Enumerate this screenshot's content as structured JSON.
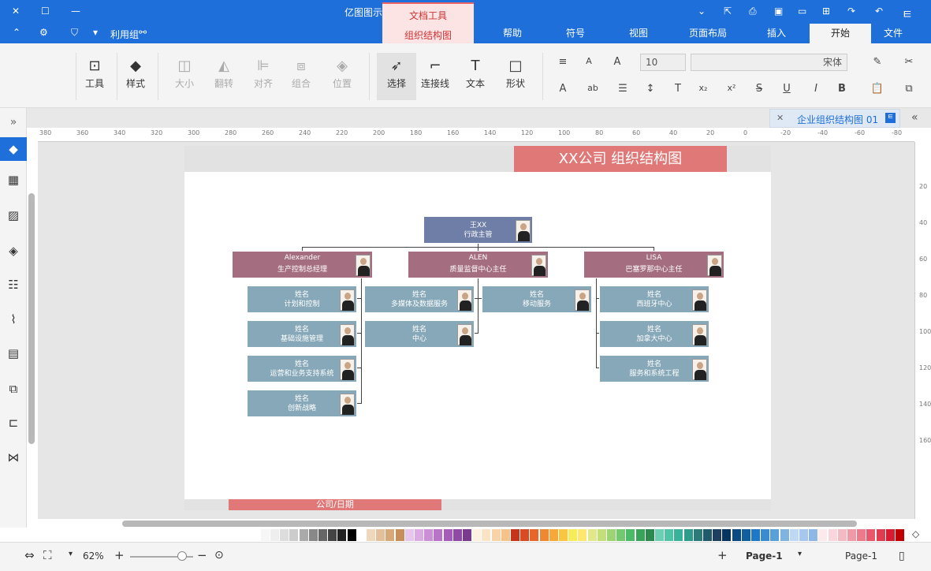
{
  "app": {
    "title": "亿图图示",
    "quick_access": [
      "利用组"
    ]
  },
  "context_tab": {
    "group": "文档工具",
    "name": "组织结构图"
  },
  "tabs": [
    "文件",
    "开始",
    "插入",
    "页面布局",
    "视图",
    "符号",
    "帮助"
  ],
  "ribbon": {
    "left_group": {
      "tool": "工具",
      "style": "样式"
    },
    "arrange": [
      "大小",
      "翻转",
      "对齐",
      "组合",
      "位置"
    ],
    "tools": {
      "select": "选择",
      "connector": "连接线",
      "text": "文本",
      "shape": "形状"
    },
    "font_name": "宋体",
    "font_size": "10",
    "buttons_row2": [
      "B",
      "I",
      "U",
      "S",
      "x²",
      "x₂"
    ]
  },
  "document_tab": "企业组织结构图 01",
  "ruler": {
    "h": [
      "380",
      "360",
      "340",
      "320",
      "300",
      "280",
      "260",
      "240",
      "220",
      "200",
      "180",
      "160",
      "140",
      "120",
      "100",
      "80",
      "60",
      "40",
      "20",
      "0",
      "-20",
      "-40",
      "-60",
      "-80"
    ],
    "v": [
      "20",
      "40",
      "60",
      "80",
      "100",
      "120",
      "140",
      "160"
    ]
  },
  "diagram": {
    "title": "XX公司  组织结构图",
    "footer": "公司/日期",
    "top": {
      "name": "王XX",
      "title": "行政主管"
    },
    "managers": [
      {
        "name": "Alexander",
        "title": "生产控制总经理"
      },
      {
        "name": "ALEN",
        "title": "质量监督中心主任"
      },
      {
        "name": "LISA",
        "title": "巴塞罗那中心主任"
      }
    ],
    "employees": [
      {
        "name": "姓名",
        "title": "计划和控制"
      },
      {
        "name": "姓名",
        "title": "基础设施管理"
      },
      {
        "name": "姓名",
        "title": "运营和业务支持系统"
      },
      {
        "name": "姓名",
        "title": "创新战略"
      },
      {
        "name": "姓名",
        "title": "多媒体及数据服务"
      },
      {
        "name": "姓名",
        "title": "中心"
      },
      {
        "name": "姓名",
        "title": "移动服务"
      },
      {
        "name": "姓名",
        "title": "西班牙中心"
      },
      {
        "name": "姓名",
        "title": "加拿大中心"
      },
      {
        "name": "姓名",
        "title": "服务和系统工程"
      }
    ]
  },
  "status": {
    "page_label": "Page-1",
    "page_tab": "Page-1",
    "zoom": "62%"
  },
  "palette": [
    "#c00000",
    "#d81b2f",
    "#e03c4f",
    "#e8586a",
    "#ec7a8a",
    "#f09aa7",
    "#f4bac3",
    "#f8d6dc",
    "#fce9ec",
    "#8db8e6",
    "#a6c8ee",
    "#bfd8f3",
    "#7fb3e0",
    "#5aa0d8",
    "#3a8ccf",
    "#1e78c6",
    "#125e9f",
    "#0b4a82",
    "#06355f",
    "#1f3f60",
    "#215a6c",
    "#2a7b7a",
    "#2e9c8a",
    "#38b29a",
    "#50c3a6",
    "#6ccfb3",
    "#2d8a4e",
    "#3aa35a",
    "#4cbb67",
    "#73c96f",
    "#9bd473",
    "#c2df7a",
    "#e0e88a",
    "#ffe66d",
    "#f6ec5a",
    "#f9c642",
    "#f6a83a",
    "#f08732",
    "#e8662a",
    "#d84b23",
    "#c4351c",
    "#f7c28a",
    "#f9d3a8",
    "#fbe3c5",
    "#fdf1e1",
    "#7a3b8f",
    "#8f4aa6",
    "#a55cba",
    "#b973c9",
    "#cc8ed6",
    "#dcaae2",
    "#e8c5ec",
    "#c78d5a",
    "#d8a878",
    "#e4c09a",
    "#efd7bb",
    "#ffffff",
    "#000000",
    "#222222",
    "#444444",
    "#666666",
    "#888888",
    "#aaaaaa",
    "#cccccc",
    "#dddddd",
    "#eeeeee",
    "#f6f6f6"
  ]
}
